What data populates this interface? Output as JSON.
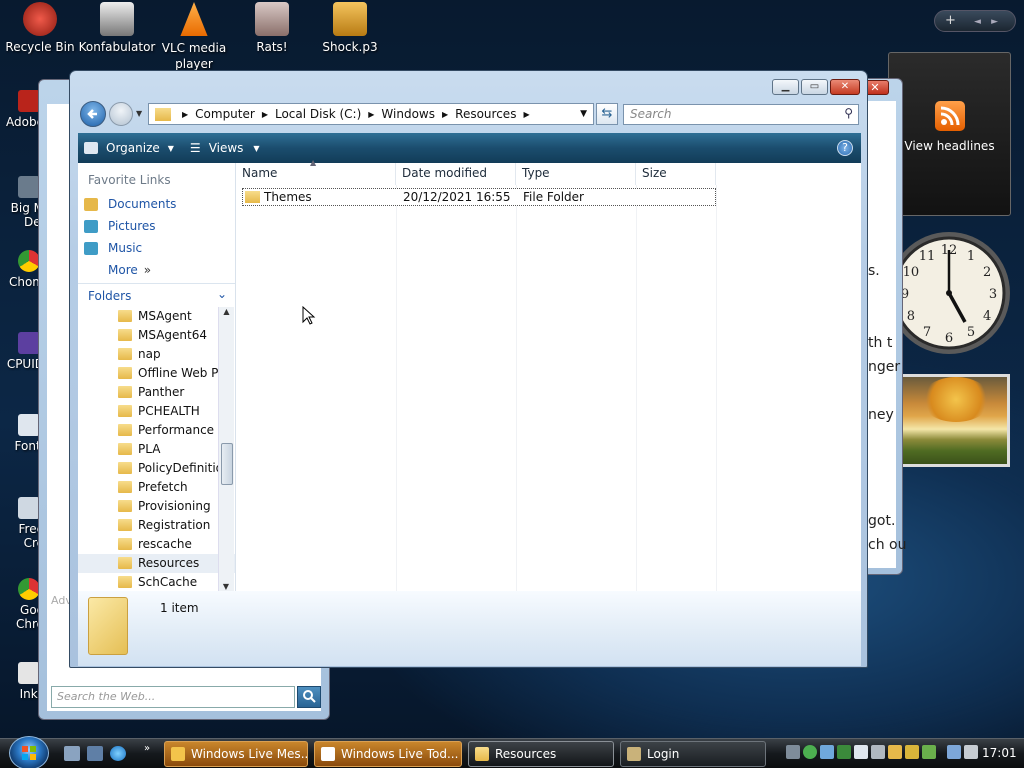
{
  "desktop": {
    "icons": [
      {
        "label": "Recycle Bin"
      },
      {
        "label": "Konfabulator"
      },
      {
        "label": "VLC media player"
      },
      {
        "label": "Rats!"
      },
      {
        "label": "Shock.p3"
      }
    ],
    "left_stubs": [
      "Adobe",
      "Big M",
      "Del",
      "Chom",
      "CPUID",
      "Fontl",
      "Free",
      "Cre",
      "Goo",
      "Chro",
      "Inks"
    ]
  },
  "sidebar_control": {
    "add": "+",
    "prev": "◄",
    "next": "►"
  },
  "gadgets": {
    "rss": {
      "label": "View headlines"
    },
    "clock": {
      "time_shown": "17:01",
      "numerals": [
        "12",
        "1",
        "2",
        "3",
        "4",
        "5",
        "6",
        "7",
        "8",
        "9",
        "10",
        "11"
      ]
    }
  },
  "back_window": {
    "search_placeholder": "Search the Web...",
    "adv_stub": "Adv"
  },
  "back_window_right": {
    "fragments": [
      "s.",
      "th t",
      "nger",
      "ney",
      "got.",
      "ch ou"
    ]
  },
  "explorer": {
    "breadcrumb": [
      "Computer",
      "Local Disk (C:)",
      "Windows",
      "Resources"
    ],
    "search_placeholder": "Search",
    "toolbar": {
      "organize": "Organize",
      "views": "Views"
    },
    "favorite_links_header": "Favorite Links",
    "favorite_links": [
      {
        "label": "Documents",
        "color": "#e6b84a"
      },
      {
        "label": "Pictures",
        "color": "#3f9cc6"
      },
      {
        "label": "Music",
        "color": "#3f9cc6"
      }
    ],
    "more_label": "More",
    "folders_header": "Folders",
    "tree": [
      "MSAgent",
      "MSAgent64",
      "nap",
      "Offline Web Pa",
      "Panther",
      "PCHEALTH",
      "Performance",
      "PLA",
      "PolicyDefinitio",
      "Prefetch",
      "Provisioning",
      "Registration",
      "rescache",
      "Resources",
      "SchCache"
    ],
    "tree_selected": "Resources",
    "columns": [
      "Name",
      "Date modified",
      "Type",
      "Size"
    ],
    "files": [
      {
        "name": "Themes",
        "modified": "20/12/2021 16:55",
        "type": "File Folder",
        "size": ""
      }
    ],
    "status": "1 item"
  },
  "taskbar": {
    "buttons": [
      {
        "label": "Windows Live Mes...",
        "style": "orange"
      },
      {
        "label": "Windows Live Tod...",
        "style": "orange"
      },
      {
        "label": "Resources",
        "style": "active"
      },
      {
        "label": "Login",
        "style": "dark"
      }
    ],
    "clock": "17:01"
  }
}
